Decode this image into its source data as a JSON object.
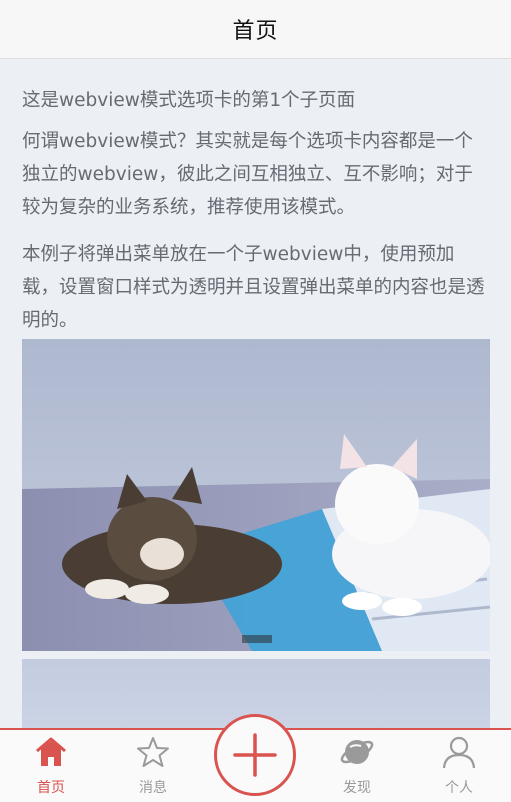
{
  "header": {
    "title": "首页"
  },
  "content": {
    "line1": "这是webview模式选项卡的第1个子页面",
    "para2": "何谓webview模式？其实就是每个选项卡内容都是一个独立的webview，彼此之间互相独立、互不影响；对于较为复杂的业务系统，推荐使用该模式。",
    "para3": "本例子将弹出菜单放在一个子webview中，使用预加载，设置窗口样式为透明并且设置弹出菜单的内容也是透明的。"
  },
  "images": [
    {
      "icon": "cats-photo-image"
    },
    {
      "icon": "second-photo-image"
    }
  ],
  "tabbar": {
    "tabs": [
      {
        "label": "首页",
        "icon": "home-icon",
        "active": true
      },
      {
        "label": "消息",
        "icon": "star-icon",
        "active": false
      },
      {
        "label": "发现",
        "icon": "planet-icon",
        "active": false
      },
      {
        "label": "个人",
        "icon": "person-icon",
        "active": false
      }
    ],
    "center": {
      "icon": "plus-icon"
    },
    "colors": {
      "accent": "#d9534f",
      "inactive": "#9a9a9a"
    }
  }
}
